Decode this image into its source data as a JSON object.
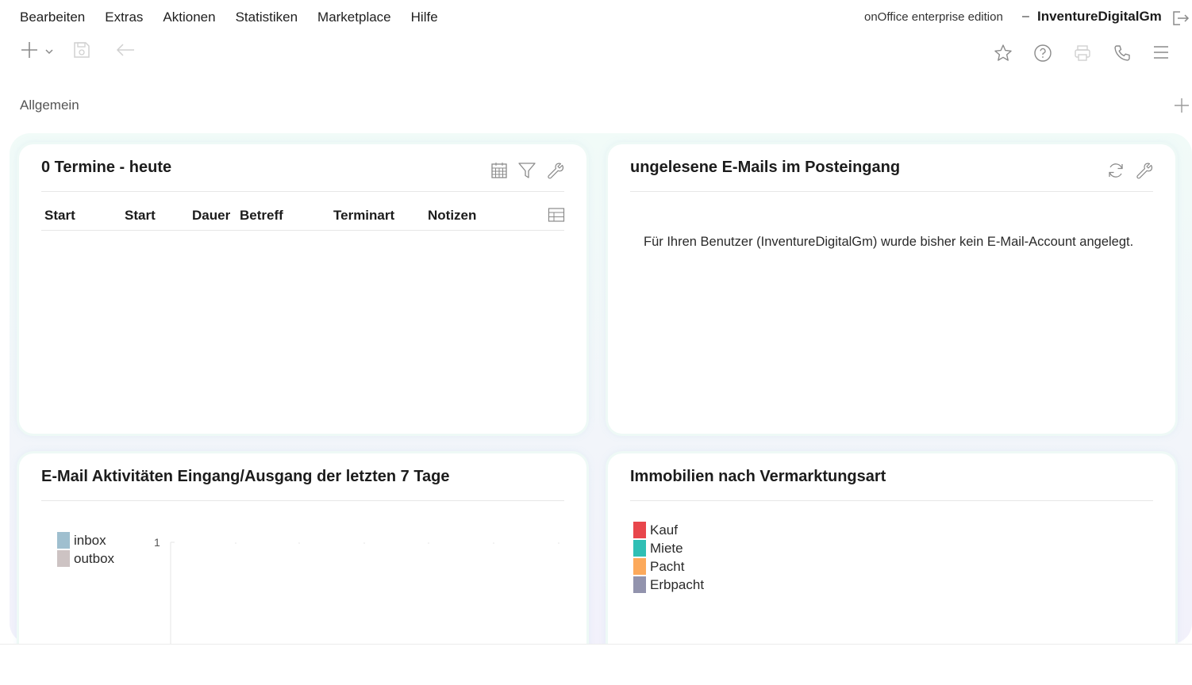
{
  "menu": {
    "items": [
      "Bearbeiten",
      "Extras",
      "Aktionen",
      "Statistiken",
      "Marketplace",
      "Hilfe"
    ]
  },
  "header": {
    "edition": "onOffice enterprise edition",
    "separator": "–",
    "account": "InventureDigitalGm"
  },
  "toolbar": {
    "left_icons": [
      "plus-icon",
      "chevron-down-icon",
      "save-icon",
      "back-arrow-icon"
    ],
    "right_icons": [
      "star-icon",
      "help-icon",
      "print-icon",
      "phone-icon",
      "menu-icon"
    ]
  },
  "section": {
    "title": "Allgemein"
  },
  "widgets": {
    "appointments": {
      "title": "0 Termine - heute",
      "columns": [
        "Start",
        "Start",
        "Dauer",
        "Betreff",
        "Terminart",
        "Notizen"
      ],
      "rows": []
    },
    "emails": {
      "title": "ungelesene E-Mails im Posteingang",
      "message": "Für Ihren Benutzer (InventureDigitalGm) wurde bisher kein E-Mail-Account angelegt."
    },
    "email_activity": {
      "title": "E-Mail Aktivitäten Eingang/Ausgang der letzten 7 Tage",
      "legend": [
        {
          "label": "inbox",
          "color": "#9fbfcf"
        },
        {
          "label": "outbox",
          "color": "#cdc3c3"
        }
      ],
      "y_tick": "1"
    },
    "properties": {
      "title": "Immobilien nach Vermarktungsart",
      "legend": [
        {
          "label": "Kauf",
          "color": "#e8464c"
        },
        {
          "label": "Miete",
          "color": "#2fbfb5"
        },
        {
          "label": "Pacht",
          "color": "#fca95b"
        },
        {
          "label": "Erbpacht",
          "color": "#9293ad"
        }
      ]
    }
  },
  "colors": {
    "icon_gray": "#8a8a8a",
    "icon_light": "#d0d0d0"
  }
}
